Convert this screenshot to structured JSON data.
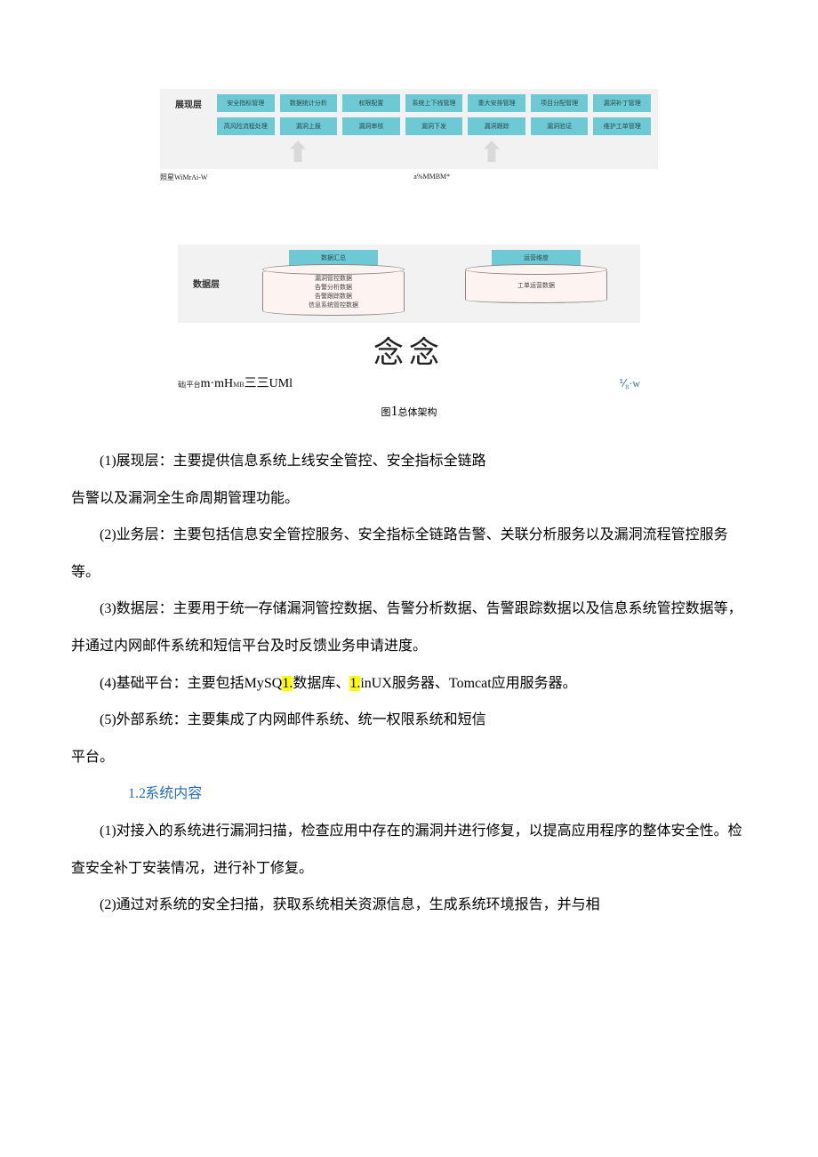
{
  "figure": {
    "panel_top": {
      "layer_label": "展现层",
      "row1": [
        "安全指标管理",
        "数据统计分析",
        "权限配置",
        "系统上下线管理",
        "重大安排管理",
        "项目分配管理",
        "漏洞补丁管理"
      ],
      "row2": [
        "高风险流程处理",
        "漏洞上报",
        "漏洞审核",
        "漏洞下发",
        "漏洞跟踪",
        "漏洞验证",
        "维护工单管理"
      ]
    },
    "annot1_left": "照星WiMrAi-W",
    "annot1_right": "a%MMBM*",
    "panel_mid": {
      "layer_label": "数据层",
      "left_pill": "数据汇总",
      "left_cyl": [
        "漏洞管控数据",
        "告警分析数据",
        "告警跟踪数据",
        "信息系统管控数据"
      ],
      "right_pill": "运营维度",
      "right_cyl": [
        "工单运营数据"
      ]
    },
    "big_chars": "念念",
    "annot2_left_prefix": "础|平台",
    "annot2_left_mix": "m·mH",
    "annot2_left_mb": "MB",
    "annot2_left_tail": "三三UMl",
    "annot2_right": "⅟₈·w",
    "caption_prefix": "图",
    "caption_num": "1",
    "caption_text": "总体架构"
  },
  "para1a": "(1)展现层：主要提供信息系统上线安全管控、安全指标全链路",
  "para1b": "告警以及漏洞全生命周期管理功能。",
  "para2": "(2)业务层：主要包括信息安全管控服务、安全指标全链路告警、关联分析服务以及漏洞流程管控服务等。",
  "para3": "(3)数据层：主要用于统一存储漏洞管控数据、告警分析数据、告警跟踪数据以及信息系统管控数据等，并通过内网邮件系统和短信平台及时反馈业务申请进度。",
  "para4_pre": "(4)基础平台：主要包括MySQ",
  "para4_hl1": "1.",
  "para4_mid": "数据库、",
  "para4_hl2": "1.",
  "para4_post": "inUX服务器、Tomcat应用服务器。",
  "para5a": "(5)外部系统：主要集成了内网邮件系统、统一权限系统和短信",
  "para5b": "平台。",
  "section": {
    "num": "1.2",
    "title": "系统内容"
  },
  "para_s1": "(1)对接入的系统进行漏洞扫描，检查应用中存在的漏洞并进行修复，以提高应用程序的整体安全性。检查安全补丁安装情况，进行补丁修复。",
  "para_s2": "(2)通过对系统的安全扫描，获取系统相关资源信息，生成系统环境报告，并与相"
}
